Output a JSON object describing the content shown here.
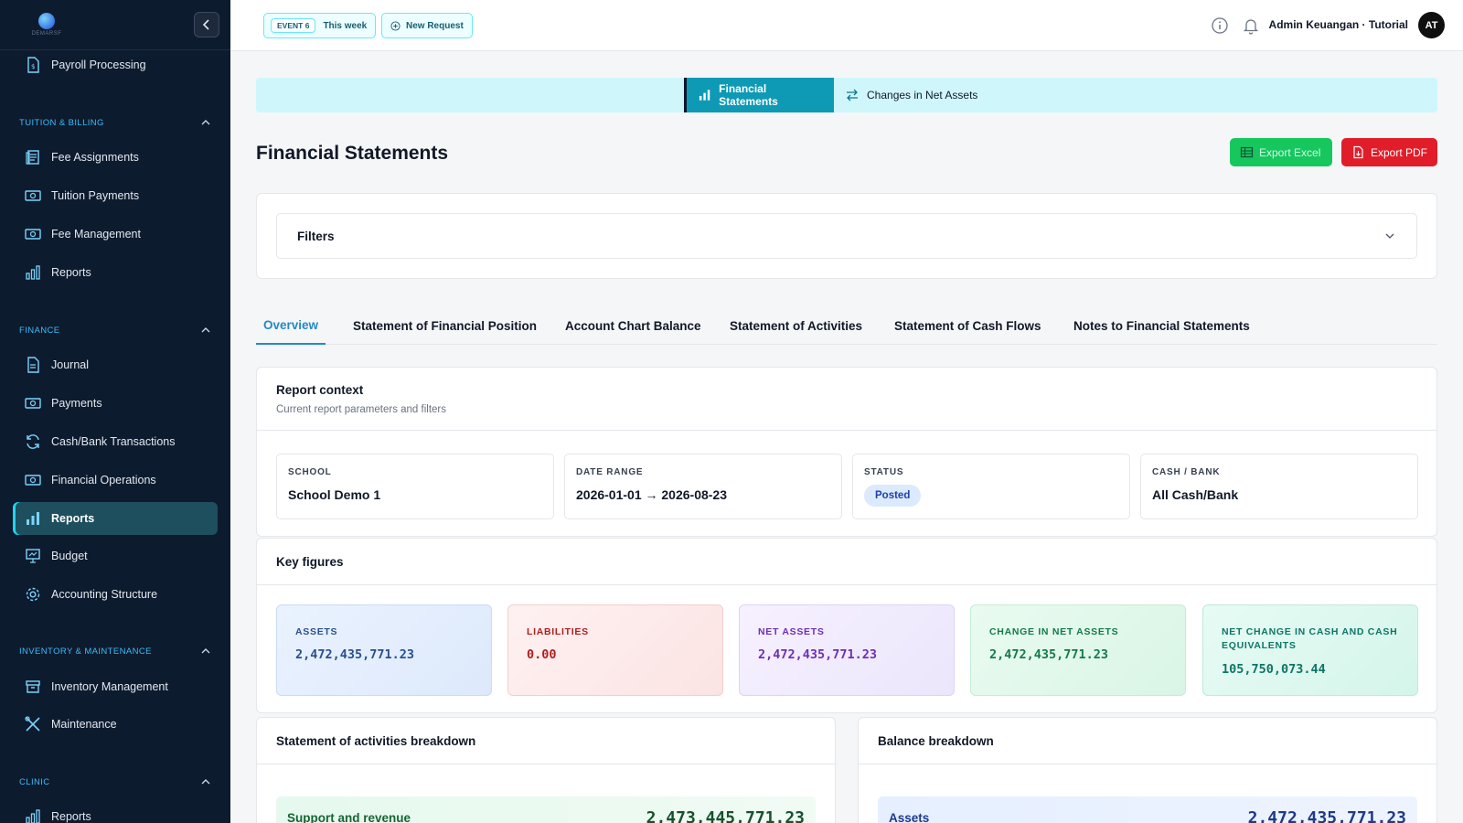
{
  "sidebar": {
    "logo_text": "DEMARSF",
    "items": {
      "payroll": "Payroll Processing",
      "fee_assignments": "Fee Assignments",
      "tuition_payments": "Tuition Payments",
      "fee_management": "Fee Management",
      "tuition_reports": "Reports",
      "journal": "Journal",
      "payments": "Payments",
      "cash_bank": "Cash/Bank Transactions",
      "financial_operations": "Financial Operations",
      "finance_reports": "Reports",
      "budget": "Budget",
      "accounting_structure": "Accounting Structure",
      "inventory_management": "Inventory Management",
      "maintenance": "Maintenance",
      "clinic_reports": "Reports"
    },
    "sections": {
      "tuition": "TUITION & BILLING",
      "finance": "FINANCE",
      "inventory": "INVENTORY & MAINTENANCE",
      "clinic": "CLINIC"
    }
  },
  "topbar": {
    "event_badge": "EVENT 6",
    "event_period": "This week",
    "new_request": "New Request",
    "user": "Admin Keuangan · Tutorial",
    "avatar": "AT"
  },
  "segments": {
    "financial_statements": "Financial Statements",
    "changes_net_assets": "Changes in Net Assets"
  },
  "page": {
    "title": "Financial Statements",
    "export_excel": "Export Excel",
    "export_pdf": "Export PDF",
    "filters": "Filters"
  },
  "tabs": {
    "overview": "Overview",
    "sofp": "Statement of Financial Position",
    "acb": "Account Chart Balance",
    "soa": "Statement of Activities",
    "socf": "Statement of Cash Flows",
    "notes": "Notes to Financial Statements"
  },
  "context": {
    "title": "Report context",
    "subtitle": "Current report parameters and filters",
    "school_label": "SCHOOL",
    "school_value": "School Demo 1",
    "date_label": "DATE RANGE",
    "date_value": "2026-01-01 → 2026-08-23",
    "status_label": "STATUS",
    "status_value": "Posted",
    "cash_label": "CASH / BANK",
    "cash_value": "All Cash/Bank"
  },
  "key_figures": {
    "title": "Key figures",
    "assets_label": "ASSETS",
    "assets_value": "2,472,435,771.23",
    "liabilities_label": "LIABILITIES",
    "liabilities_value": "0.00",
    "net_assets_label": "NET ASSETS",
    "net_assets_value": "2,472,435,771.23",
    "change_label": "CHANGE IN NET ASSETS",
    "change_value": "2,472,435,771.23",
    "cash_change_label": "NET CHANGE IN CASH AND CASH EQUIVALENTS",
    "cash_change_value": "105,750,073.44"
  },
  "activities_breakdown": {
    "title": "Statement of activities breakdown",
    "row_label": "Support and revenue",
    "row_value": "2,473,445,771.23"
  },
  "balance_breakdown": {
    "title": "Balance breakdown",
    "row_label": "Assets",
    "row_value": "2,472,435,771.23"
  },
  "colors": {
    "sidebar_bg": "#0d1b2e",
    "accent": "#0e9ab5",
    "tab_active": "#2589c5",
    "excel": "#16c75e",
    "pdf": "#e11d2a"
  }
}
